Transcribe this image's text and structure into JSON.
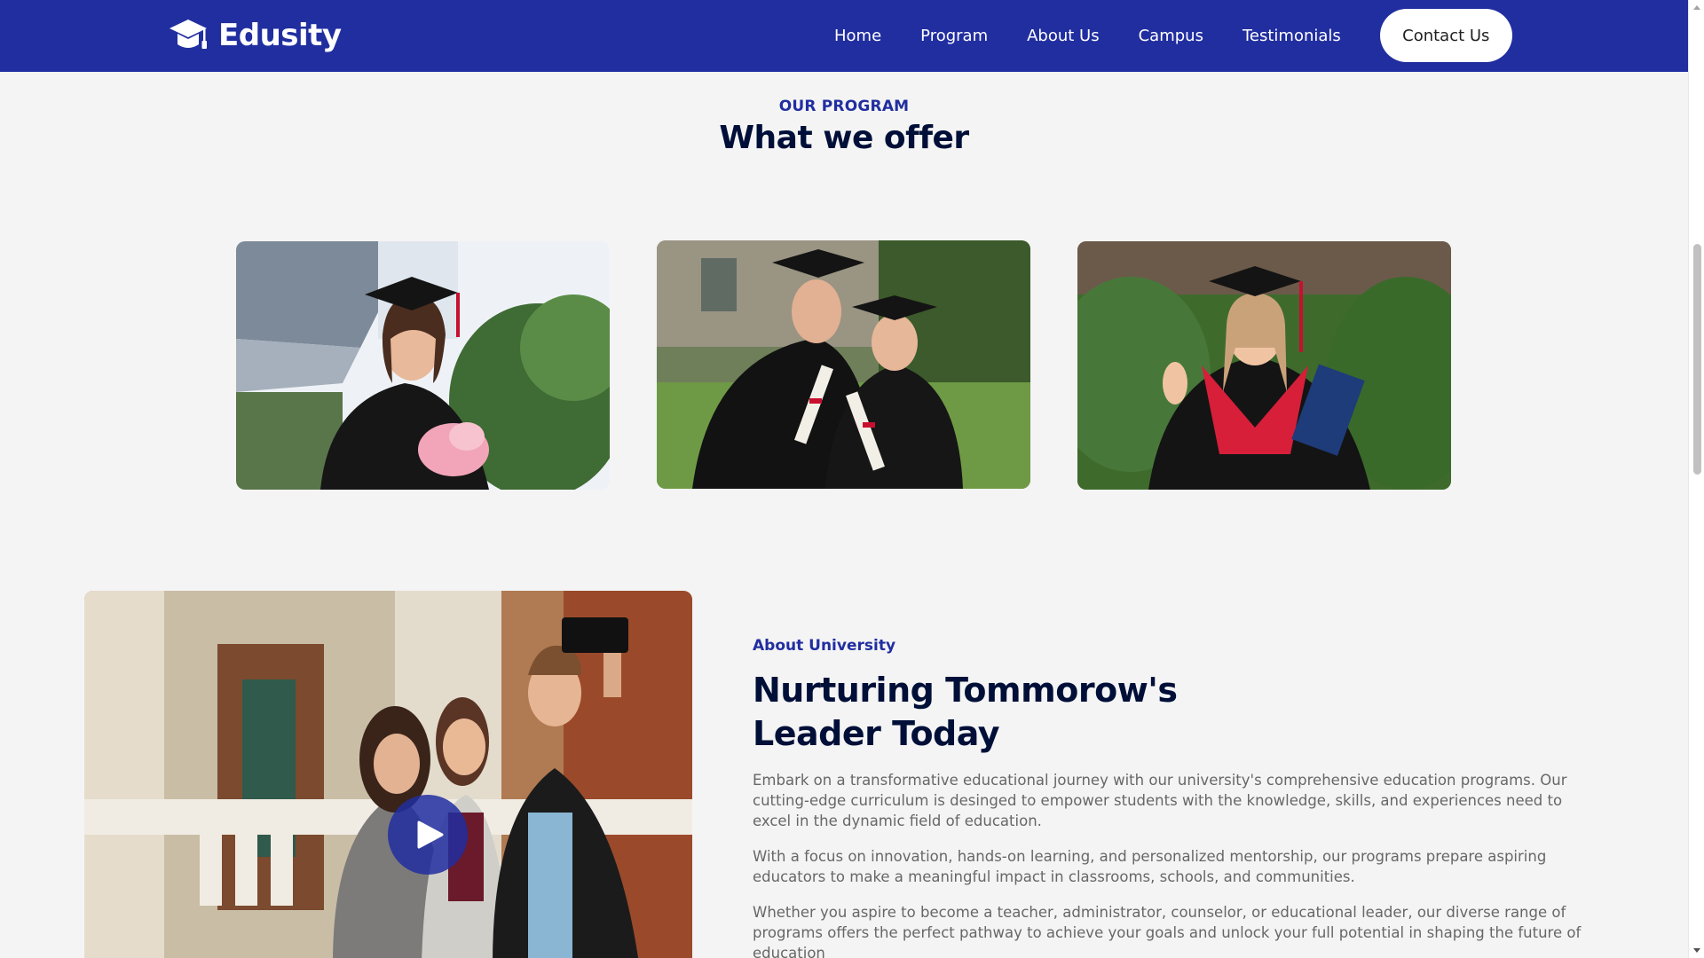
{
  "brand": {
    "name": "Edusity",
    "logo_icon": "graduation-cap-icon"
  },
  "nav": {
    "items": [
      {
        "label": "Home"
      },
      {
        "label": "Program"
      },
      {
        "label": "About Us"
      },
      {
        "label": "Campus"
      },
      {
        "label": "Testimonials"
      }
    ],
    "contact_label": "Contact Us"
  },
  "program": {
    "subtitle": "OUR PROGRAM",
    "title": "What we offer",
    "images": [
      {
        "alt": "graduate-woman-with-flowers"
      },
      {
        "alt": "graduate-couple-with-diplomas"
      },
      {
        "alt": "graduate-woman-ok-gesture"
      }
    ]
  },
  "about": {
    "subtitle": "About University",
    "title": "Nurturing Tommorow's Leader Today",
    "paragraphs": [
      "Embark on a transformative educational journey with our university's comprehensive education programs. Our cutting-edge curriculum is desinged to empower students with the knowledge, skills, and experiences need to excel in the dynamic field of education.",
      "With a focus on innovation, hands-on learning, and personalized mentorship, our programs prepare aspiring educators to make a meaningful impact in classrooms, schools, and communities.",
      "Whether you aspire to become a teacher, administrator, counselor, or educational leader, our diverse range of programs offers the perfect pathway to achieve your goals and unlock your full potential in shaping the future of education"
    ],
    "play_icon": "play-icon"
  },
  "colors": {
    "primary": "#212ea0",
    "dark": "#000f38",
    "background": "#f4f4f4",
    "text_muted": "#676767"
  }
}
